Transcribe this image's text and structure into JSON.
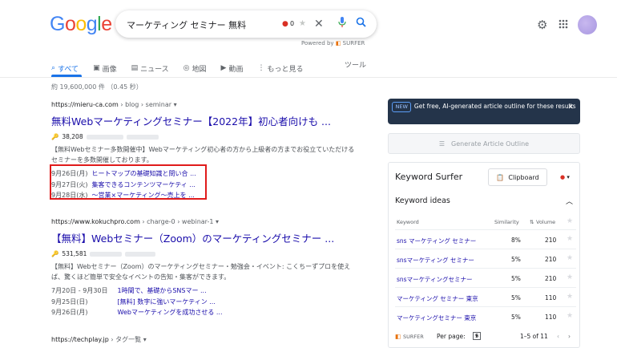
{
  "header": {
    "logo": "Google",
    "query": "マーケティング セミナー 無料",
    "badge_count": "0",
    "powered_by_label": "Powered by",
    "powered_by_brand": "SURFER"
  },
  "tabs": [
    {
      "label": "すべて",
      "icon": "search-icon"
    },
    {
      "label": "画像",
      "icon": "image-icon"
    },
    {
      "label": "ニュース",
      "icon": "news-icon"
    },
    {
      "label": "地図",
      "icon": "map-pin-icon"
    },
    {
      "label": "動画",
      "icon": "video-icon"
    },
    {
      "label": "もっと見る",
      "icon": "more-vert-icon"
    }
  ],
  "tools_label": "ツール",
  "result_count": "約 19,600,000 件 （0.45 秒）",
  "results": [
    {
      "url": "https://mieru-ca.com",
      "crumb": "› blog › seminar",
      "title": "無料Webマーケティングセミナー【2022年】初心者向けも ...",
      "metric": "38,208",
      "snippet": "【無料Webセミナー多数開催中】Webマーケティング初心者の方から上級者の方までお役立ていただけるセミナーを多数開催しております。",
      "sublinks": [
        {
          "date": "9月26日(月)",
          "text": "ヒートマップの基礎知識と問い合 ..."
        },
        {
          "date": "9月27日(火)",
          "text": "集客できるコンテンツマーケティ ..."
        },
        {
          "date": "9月28日(水)",
          "text": "～営業×マーケティング～売上を ..."
        }
      ]
    },
    {
      "url": "https://www.kokuchpro.com",
      "crumb": "› charge-0 › webinar-1",
      "title": "【無料】Webセミナー（Zoom）のマーケティングセミナー ...",
      "metric": "531,581",
      "snippet": "【無料】Webセミナー（Zoom）のマーケティングセミナー・勉強会・イベント: こくちーずプロを使えば、驚くほど簡単で安全なイベントの告知・集客ができます。",
      "sublinks": [
        {
          "date": "7月20日 - 9月30日",
          "text": "1時間で、基礎からSNSマー ..."
        },
        {
          "date": "9月25日(日)",
          "text": "[無料] 数字に強いマーケティン ..."
        },
        {
          "date": "9月26日(月)",
          "text": "Webマーケティングを成功させる ..."
        }
      ]
    },
    {
      "url": "https://techplay.jp",
      "crumb": "› タグ一覧"
    }
  ],
  "banner": {
    "new_label": "NEW",
    "text": "Get free, AI-generated article outline for these results"
  },
  "generate_button": "Generate Article Outline",
  "keyword_surfer": {
    "title": "Keyword Surfer",
    "clipboard_label": "Clipboard",
    "section": "Keyword ideas",
    "columns": {
      "keyword": "Keyword",
      "similarity": "Similarity",
      "volume": "Volume"
    },
    "rows": [
      {
        "keyword": "sns マーケティング セミナー",
        "similarity": "8%",
        "volume": "210"
      },
      {
        "keyword": "snsマーケティング セミナー",
        "similarity": "5%",
        "volume": "210"
      },
      {
        "keyword": "snsマーケティングセミナー",
        "similarity": "5%",
        "volume": "210"
      },
      {
        "keyword": "マーケティング セミナー 東京",
        "similarity": "5%",
        "volume": "110"
      },
      {
        "keyword": "マーケティングセミナー 東京",
        "similarity": "5%",
        "volume": "110"
      }
    ],
    "footer": {
      "brand": "SURFER",
      "per_page_label": "Per page:",
      "per_page_value": "5",
      "range": "1–5 of 11"
    }
  },
  "colors": {
    "accent": "#1a73e8",
    "link": "#1a0dab",
    "highlight_box": "#e01b1b",
    "banner_bg": "#24344a"
  }
}
